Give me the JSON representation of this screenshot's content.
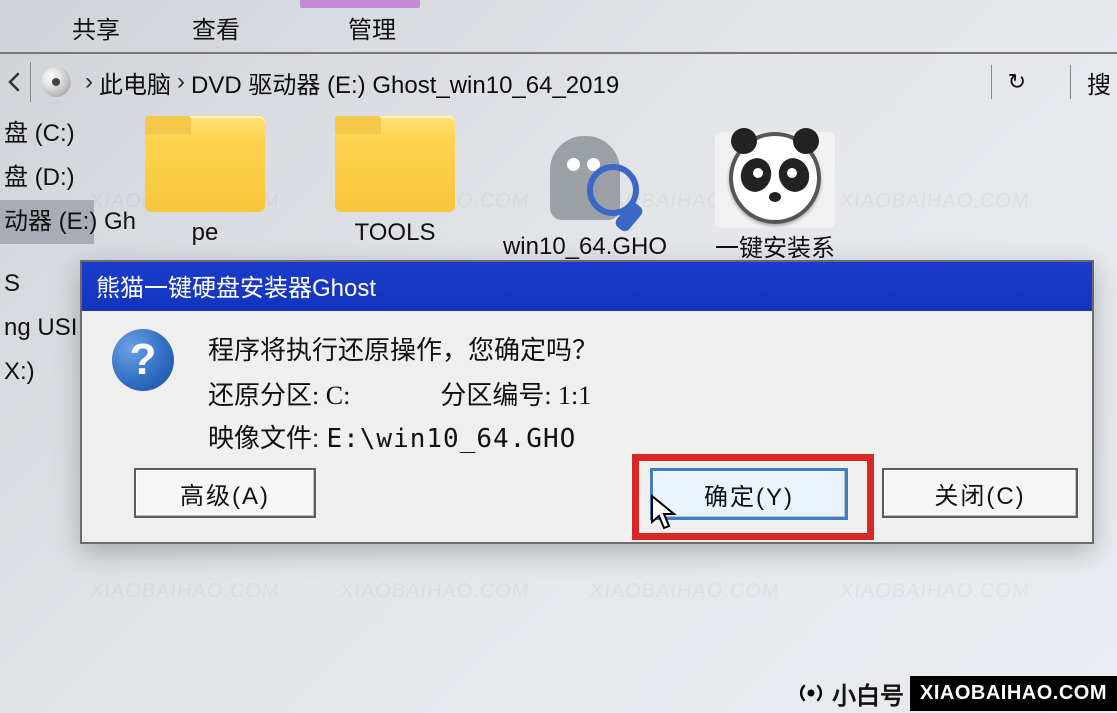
{
  "ribbon": {
    "share": "共享",
    "view": "查看",
    "manage": "管理"
  },
  "breadcrumb": {
    "this_pc": "此电脑",
    "drive": "DVD 驱动器 (E:) Ghost_win10_64_2019",
    "sep": "›"
  },
  "toolbar": {
    "search_placeholder": "搜"
  },
  "nav": {
    "local_c": "盘 (C:)",
    "local_d": "盘 (D:)",
    "dvd_e": "动器 (E:) Gh",
    "s": "S",
    "usb": "ng USI",
    "x": "X:)"
  },
  "files": {
    "pe": "pe",
    "tools": "TOOLS",
    "gho": "win10_64.GHO",
    "installer": "一键安装系统.exe"
  },
  "dialog": {
    "title": "熊猫一键硬盘安装器Ghost",
    "confirm": "程序将执行还原操作，您确定吗？",
    "partition_label": "还原分区:",
    "partition_value": "C:",
    "index_label": "分区编号:",
    "index_value": "1:1",
    "image_label": "映像文件:",
    "image_value": "E:\\win10_64.GHO",
    "advanced": "高级(A)",
    "ok": "确定(Y)",
    "close": "关闭(C)"
  },
  "watermark": {
    "text": "XIAOBAIHAO.COM"
  },
  "footer": {
    "cn": "小白号",
    "en": "XIAOBAIHAO.COM"
  }
}
